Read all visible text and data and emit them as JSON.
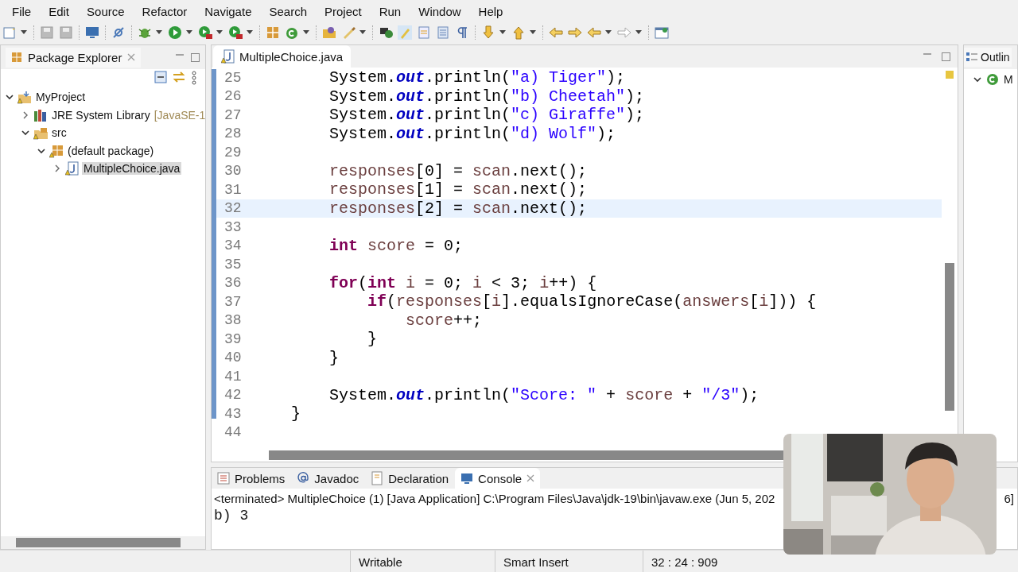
{
  "menu": [
    "File",
    "Edit",
    "Source",
    "Refactor",
    "Navigate",
    "Search",
    "Project",
    "Run",
    "Window",
    "Help"
  ],
  "package_explorer": {
    "title": "Package Explorer",
    "tree": [
      {
        "label": "MyProject",
        "expanded": true,
        "children": [
          {
            "label": "JRE System Library",
            "suffix": "[JavaSE-1",
            "expanded": false,
            "selected": false
          },
          {
            "label": "src",
            "expanded": true,
            "children": [
              {
                "label": "(default package)",
                "expanded": true,
                "children": [
                  {
                    "label": "MultipleChoice.java",
                    "expanded": false,
                    "selected": true
                  }
                ]
              }
            ]
          }
        ]
      }
    ]
  },
  "editor": {
    "tab": "MultipleChoice.java",
    "lines": [
      {
        "number": "25",
        "current": false,
        "tokens": [
          {
            "kind": "plain",
            "text": "        System."
          },
          {
            "kind": "field",
            "text": "out"
          },
          {
            "kind": "plain",
            "text": ".println("
          },
          {
            "kind": "string",
            "text": "\"a) Tiger\""
          },
          {
            "kind": "plain",
            "text": ");"
          }
        ]
      },
      {
        "number": "26",
        "current": false,
        "tokens": [
          {
            "kind": "plain",
            "text": "        System."
          },
          {
            "kind": "field",
            "text": "out"
          },
          {
            "kind": "plain",
            "text": ".println("
          },
          {
            "kind": "string",
            "text": "\"b) Cheetah\""
          },
          {
            "kind": "plain",
            "text": ");"
          }
        ]
      },
      {
        "number": "27",
        "current": false,
        "tokens": [
          {
            "kind": "plain",
            "text": "        System."
          },
          {
            "kind": "field",
            "text": "out"
          },
          {
            "kind": "plain",
            "text": ".println("
          },
          {
            "kind": "string",
            "text": "\"c) Giraffe\""
          },
          {
            "kind": "plain",
            "text": ");"
          }
        ]
      },
      {
        "number": "28",
        "current": false,
        "tokens": [
          {
            "kind": "plain",
            "text": "        System."
          },
          {
            "kind": "field",
            "text": "out"
          },
          {
            "kind": "plain",
            "text": ".println("
          },
          {
            "kind": "string",
            "text": "\"d) Wolf\""
          },
          {
            "kind": "plain",
            "text": ");"
          }
        ]
      },
      {
        "number": "29",
        "current": false
      },
      {
        "number": "30",
        "current": false,
        "tokens": [
          {
            "kind": "var",
            "text": "        responses"
          },
          {
            "kind": "plain",
            "text": "[0] = "
          },
          {
            "kind": "var",
            "text": "scan"
          },
          {
            "kind": "plain",
            "text": ".next();"
          }
        ]
      },
      {
        "number": "31",
        "current": false,
        "tokens": [
          {
            "kind": "var",
            "text": "        responses"
          },
          {
            "kind": "plain",
            "text": "[1] = "
          },
          {
            "kind": "var",
            "text": "scan"
          },
          {
            "kind": "plain",
            "text": ".next();"
          }
        ]
      },
      {
        "number": "32",
        "current": true,
        "tokens": [
          {
            "kind": "var",
            "text": "        responses"
          },
          {
            "kind": "plain",
            "text": "[2] = "
          },
          {
            "kind": "var",
            "text": "scan"
          },
          {
            "kind": "plain",
            "text": ".next();"
          }
        ]
      },
      {
        "number": "33",
        "current": false
      },
      {
        "number": "34",
        "current": false,
        "tokens": [
          {
            "kind": "keyword",
            "text": "        int"
          },
          {
            "kind": "var",
            "text": " score"
          },
          {
            "kind": "plain",
            "text": " = 0;"
          }
        ]
      },
      {
        "number": "35",
        "current": false
      },
      {
        "number": "36",
        "current": false,
        "tokens": [
          {
            "kind": "keyword",
            "text": "        for"
          },
          {
            "kind": "plain",
            "text": "("
          },
          {
            "kind": "keyword",
            "text": "int"
          },
          {
            "kind": "var",
            "text": " i"
          },
          {
            "kind": "plain",
            "text": " = 0; "
          },
          {
            "kind": "var",
            "text": "i"
          },
          {
            "kind": "plain",
            "text": " < 3; "
          },
          {
            "kind": "var",
            "text": "i"
          },
          {
            "kind": "plain",
            "text": "++) {"
          }
        ]
      },
      {
        "number": "37",
        "current": false,
        "tokens": [
          {
            "kind": "keyword",
            "text": "            if"
          },
          {
            "kind": "plain",
            "text": "("
          },
          {
            "kind": "var",
            "text": "responses"
          },
          {
            "kind": "plain",
            "text": "["
          },
          {
            "kind": "var",
            "text": "i"
          },
          {
            "kind": "plain",
            "text": "].equalsIgnoreCase("
          },
          {
            "kind": "var",
            "text": "answers"
          },
          {
            "kind": "plain",
            "text": "["
          },
          {
            "kind": "var",
            "text": "i"
          },
          {
            "kind": "plain",
            "text": "])) {"
          }
        ]
      },
      {
        "number": "38",
        "current": false,
        "tokens": [
          {
            "kind": "var",
            "text": "                score"
          },
          {
            "kind": "plain",
            "text": "++;"
          }
        ]
      },
      {
        "number": "39",
        "current": false,
        "tokens": [
          {
            "kind": "plain",
            "text": "            }"
          }
        ]
      },
      {
        "number": "40",
        "current": false,
        "tokens": [
          {
            "kind": "plain",
            "text": "        }"
          }
        ]
      },
      {
        "number": "41",
        "current": false
      },
      {
        "number": "42",
        "current": false,
        "tokens": [
          {
            "kind": "plain",
            "text": "        System."
          },
          {
            "kind": "field",
            "text": "out"
          },
          {
            "kind": "plain",
            "text": ".println("
          },
          {
            "kind": "string",
            "text": "\"Score: \""
          },
          {
            "kind": "plain",
            "text": " + "
          },
          {
            "kind": "var",
            "text": "score"
          },
          {
            "kind": "plain",
            "text": " + "
          },
          {
            "kind": "string",
            "text": "\"/3\""
          },
          {
            "kind": "plain",
            "text": ");"
          }
        ]
      },
      {
        "number": "43",
        "current": false,
        "tokens": [
          {
            "kind": "plain",
            "text": "    }"
          }
        ]
      },
      {
        "number": "44",
        "current": false
      }
    ]
  },
  "outline": {
    "title": "Outlin",
    "item": "M"
  },
  "bottom_tabs": [
    {
      "label": "Problems",
      "selected": false
    },
    {
      "label": "Javadoc",
      "selected": false
    },
    {
      "label": "Declaration",
      "selected": false
    },
    {
      "label": "Console",
      "selected": true
    }
  ],
  "console": {
    "header": "<terminated> MultipleChoice (1) [Java Application] C:\\Program Files\\Java\\jdk-19\\bin\\javaw.exe  (Jun 5, 202",
    "header_end": "6]",
    "output": [
      "b) 3"
    ]
  },
  "webcam": {
    "kind": "picture"
  },
  "status_bar": [
    "Writable",
    "Smart Insert",
    "32 : 24 : 909"
  ]
}
